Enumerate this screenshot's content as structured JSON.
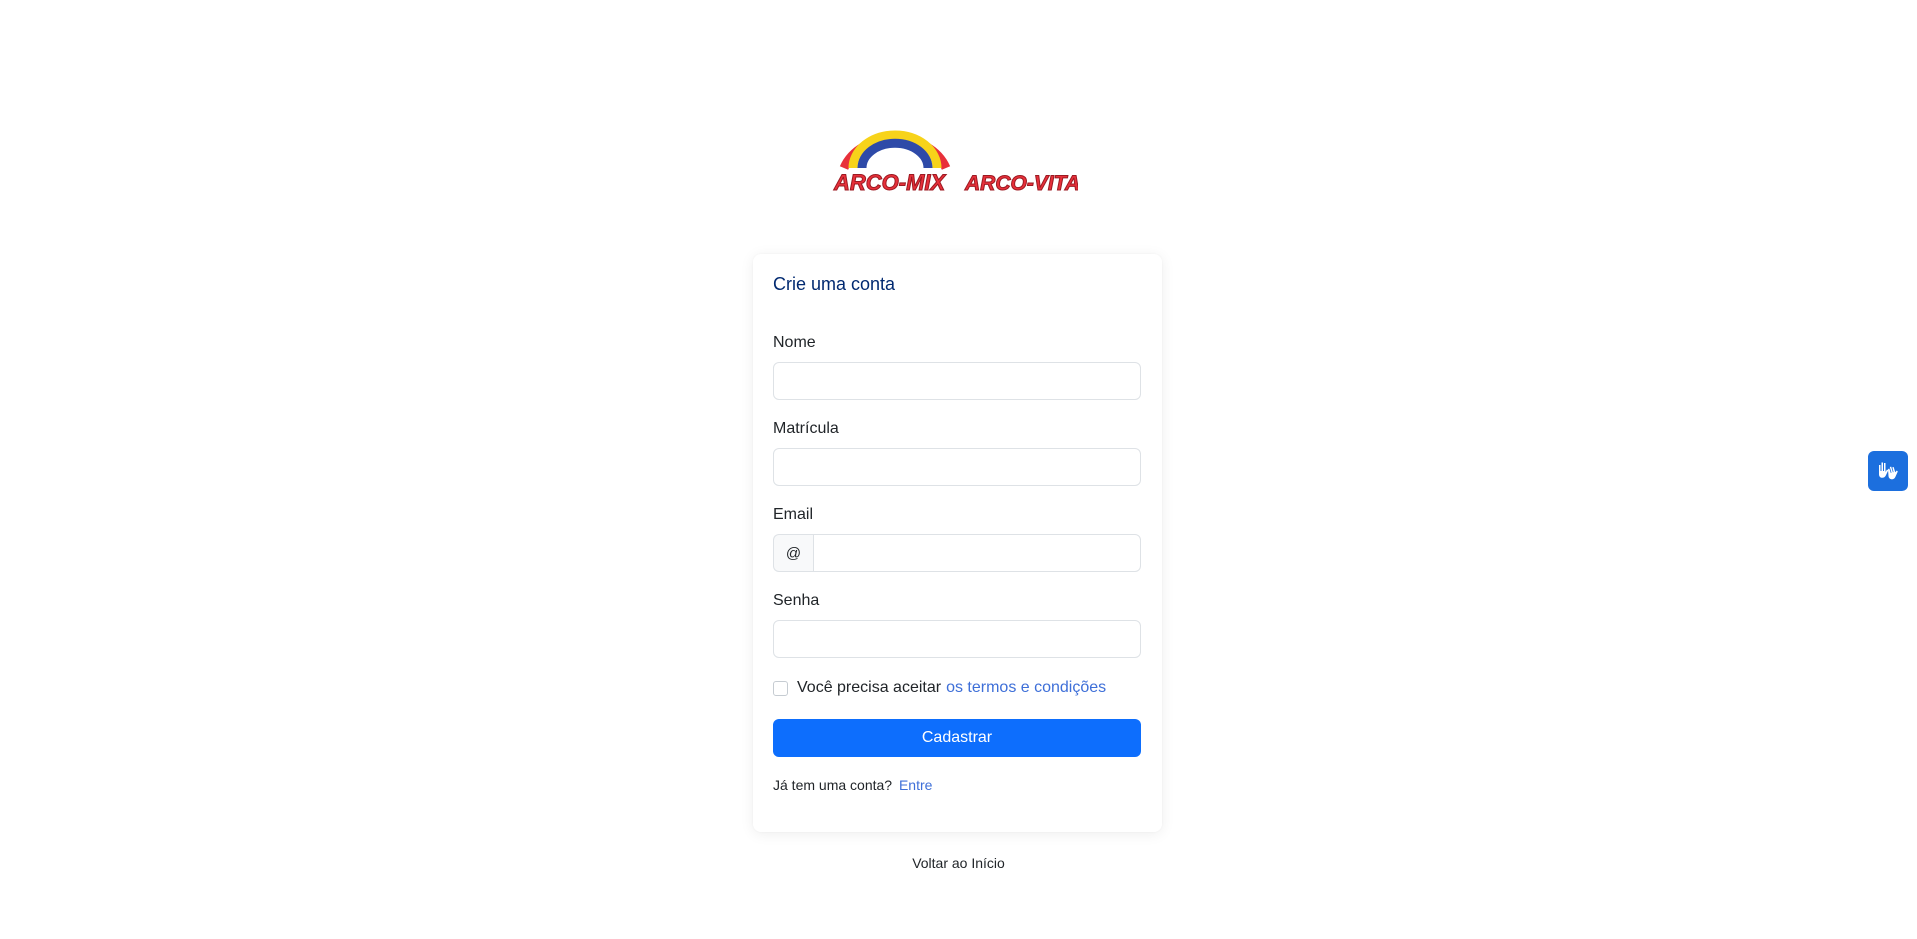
{
  "logo": {
    "brand_left": "ARCO-MIX",
    "brand_right": "ARCO-VITA"
  },
  "card": {
    "title": "Crie uma conta"
  },
  "form": {
    "name_label": "Nome",
    "name_value": "",
    "registration_label": "Matrícula",
    "registration_value": "",
    "email_label": "Email",
    "email_prefix": "@",
    "email_value": "",
    "password_label": "Senha",
    "password_value": "",
    "terms_text": "Você precisa aceitar",
    "terms_link": "os termos e condições",
    "terms_checked": false,
    "submit_label": "Cadastrar",
    "login_prompt": "Já tem uma conta?",
    "login_link": "Entre"
  },
  "footer": {
    "back_link": "Voltar ao Início"
  },
  "accessibility_widget": {
    "icon": "sign-language-hands-icon"
  },
  "colors": {
    "primary": "#0d6efd",
    "title": "#012970",
    "link": "#3e6fd8",
    "widget": "#1c6fde"
  }
}
